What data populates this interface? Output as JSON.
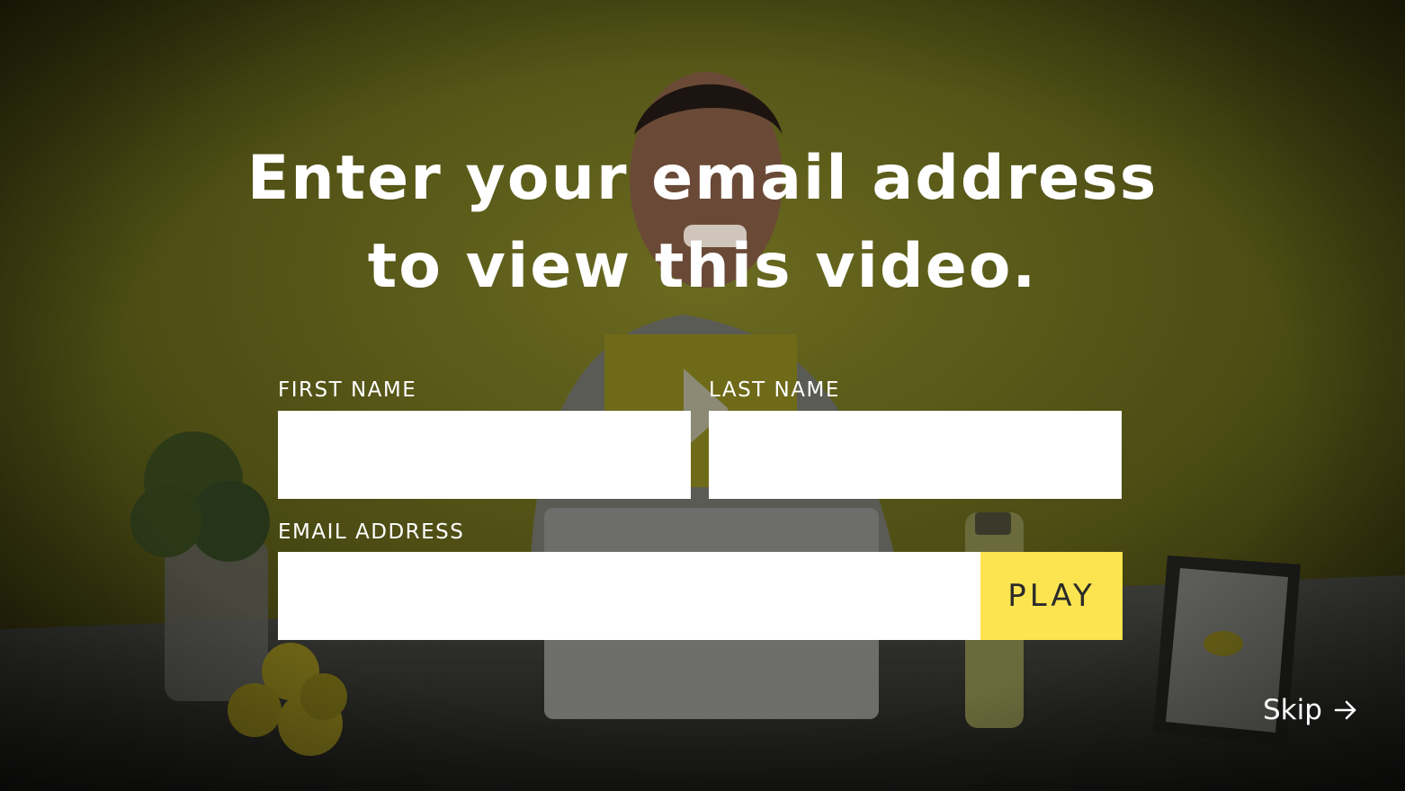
{
  "overlay": {
    "headline_line1": "Enter your email address",
    "headline_line2": "to view this video."
  },
  "form": {
    "first_name_label": "FIRST NAME",
    "last_name_label": "LAST NAME",
    "email_label": "EMAIL ADDRESS",
    "first_name_value": "",
    "last_name_value": "",
    "email_value": "",
    "play_label": "PLAY"
  },
  "skip": {
    "label": "Skip",
    "icon": "arrow-right-icon"
  },
  "colors": {
    "accent_button": "#fbe44f",
    "wall": "#5a5a18",
    "text": "#ffffff"
  }
}
